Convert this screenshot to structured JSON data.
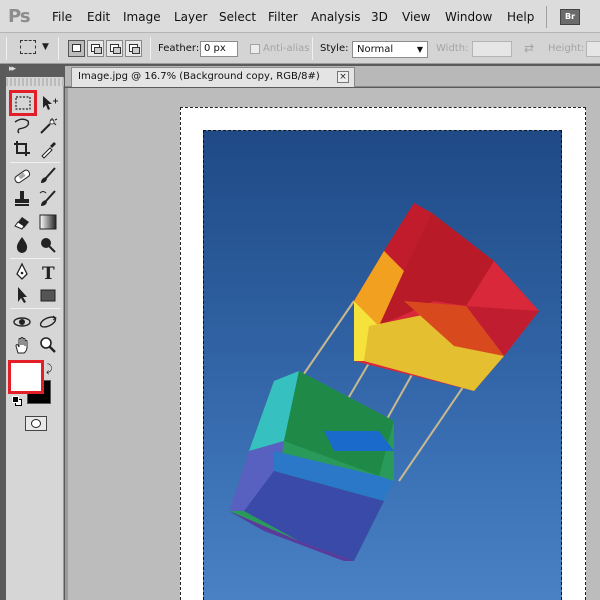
{
  "app": {
    "logo": "Ps",
    "bridge_label": "Br"
  },
  "menu": [
    "File",
    "Edit",
    "Image",
    "Layer",
    "Select",
    "Filter",
    "Analysis",
    "3D",
    "View",
    "Window",
    "Help"
  ],
  "options": {
    "feather_label": "Feather:",
    "feather_value": "0 px",
    "antialias_label": "Anti-alias",
    "style_label": "Style:",
    "style_value": "Normal",
    "width_label": "Width:",
    "height_label": "Height:"
  },
  "tools": {
    "highlight_color": "#e41e26",
    "items": [
      "rectangular-marquee",
      "move",
      "lasso",
      "quick-selection",
      "crop",
      "eyedropper",
      "spot-healing-brush",
      "brush",
      "clone-stamp",
      "history-brush",
      "eraser",
      "gradient",
      "blur",
      "dodge",
      "pen",
      "type",
      "path-selection",
      "rectangle",
      "3d-rotate",
      "3d-orbit",
      "hand",
      "zoom"
    ],
    "foreground_color": "#ffffff",
    "background_color": "#000000"
  },
  "document": {
    "tab_title": "Image.jpg @ 16.7% (Background copy, RGB/8#)",
    "close_label": "×"
  }
}
